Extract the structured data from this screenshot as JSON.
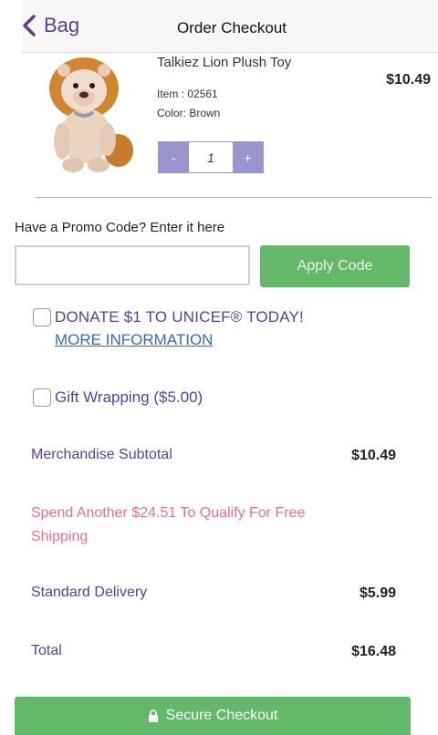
{
  "header": {
    "back_label": "Bag",
    "title": "Order Checkout"
  },
  "product": {
    "name": "Talkiez Lion Plush Toy",
    "price": "$10.49",
    "item_number": "Item : 02561",
    "color": "Color: Brown",
    "quantity": "1",
    "minus_label": "-",
    "plus_label": "+"
  },
  "promo": {
    "label": "Have a Promo Code? Enter it here",
    "input_value": "",
    "apply_label": "Apply Code"
  },
  "donate": {
    "label": "DONATE $1 TO UNICEF® TODAY!",
    "link": "MORE INFORMATION",
    "checked": false
  },
  "gift": {
    "label": "Gift Wrapping ($5.00)",
    "checked": false
  },
  "summary": {
    "subtotal_label": "Merchandise Subtotal",
    "subtotal_value": "$10.49",
    "shipping_note": "Spend Another $24.51 To Qualify For Free Shipping",
    "delivery_label": "Standard Delivery",
    "delivery_value": "$5.99",
    "total_label": "Total",
    "total_value": "$16.48"
  },
  "checkout": {
    "label": "Secure Checkout"
  },
  "colors": {
    "brand_purple": "#5a3f96",
    "accent_green": "#63b86a",
    "stepper_lavender": "#9a94cf",
    "notice_pink": "#e56d95",
    "link_blue": "#2a6fb5"
  },
  "icons": {
    "back": "chevron-left-icon",
    "checkout": "lock-icon"
  }
}
